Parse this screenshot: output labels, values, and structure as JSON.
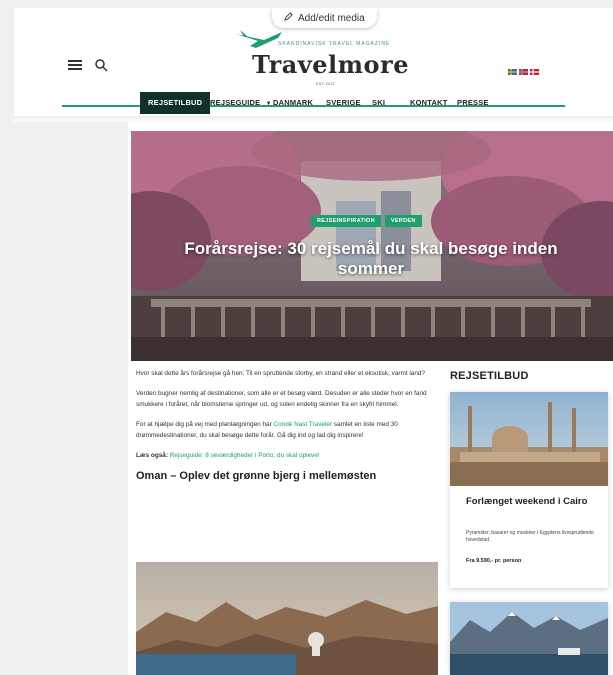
{
  "top_badge": {
    "label": "Add/edit media"
  },
  "header": {
    "logo_tagline": "SKANDINAVISK TRAVEL MAGAZINE",
    "logo_name": "Travelmore",
    "logo_since": "EST. 2013"
  },
  "nav": {
    "items": [
      {
        "label": "REJSETILBUD"
      },
      {
        "label": "REJSEGUIDE"
      },
      {
        "label": "DANMARK"
      },
      {
        "label": "SVERIGE"
      },
      {
        "label": "SKI"
      },
      {
        "label": "KONTAKT"
      },
      {
        "label": "PRESSE"
      }
    ]
  },
  "hero": {
    "categories": [
      "REJSEINSPIRATION",
      "VERDEN"
    ],
    "title": "Forårsrejse: 30 rejsemål du skal besøge inden sommer"
  },
  "article": {
    "p1": "Hvor skal dette års forårsrejse gå hen: Til en spruttende storby, en strand eller et eksotisk, varmt land?",
    "p2": "Verden bugner nemlig af destinationer, som alle er et besøg værd. Desuden er alle steder hvor en fand smukkere i foråret, når blomsterne springer ud, og solen endelig skinner fra en skyfri himmel.",
    "p3_before": "For at hjælpe dig på vej med planlægningen har ",
    "p3_link": "Condé Nast Traveler",
    "p3_after": " samlet en liste med 30 drømmedestinationer, du skal besøge dette forår. Gå dig ind og lad dig inspirere!",
    "read_also_label": "Læs også:",
    "read_also_link": "Rejseguide: 8 seværdigheder i Porto, du skal opleve!",
    "heading": "Oman – Oplev det grønne bjerg i mellemøsten"
  },
  "sidebar": {
    "title": "REJSETILBUD",
    "deal": {
      "title": "Forlænget weekend i Cairo",
      "description": "Pyramider, basarer og moskéer i Egyptens livssprudlende hovedstad.",
      "price": "Fra 9.590,- pr. person"
    }
  },
  "colors": {
    "accent": "#1f9e6e",
    "nav_active": "#10302a"
  },
  "icons": [
    "edit-icon",
    "hamburger-icon",
    "search-icon",
    "chevron-down-icon",
    "flag-sweden-icon",
    "flag-norway-icon",
    "flag-denmark-icon"
  ]
}
